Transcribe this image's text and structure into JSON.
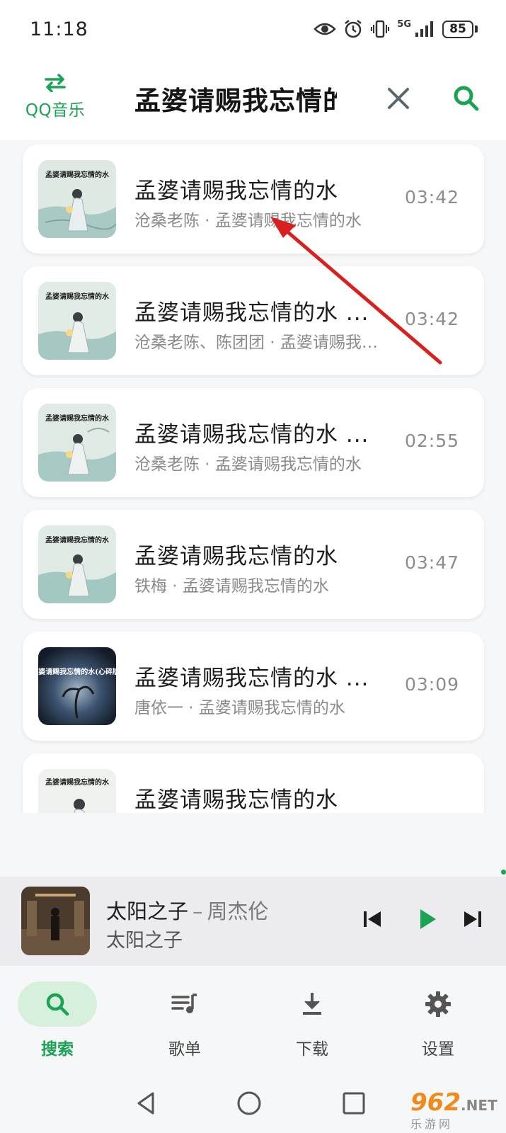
{
  "status_bar": {
    "time": "11:18",
    "network": "5G",
    "battery": "85",
    "icons": [
      "eye-icon",
      "alarm-icon",
      "vibrate-icon",
      "signal-icon",
      "battery-icon"
    ]
  },
  "header": {
    "source_label": "QQ音乐",
    "search_query": "孟婆请赐我忘情的水",
    "icons": [
      "swap-icon",
      "close-icon",
      "search-icon"
    ]
  },
  "results": [
    {
      "title": "孟婆请赐我忘情的水",
      "subtitle": "沧桑老陈 · 孟婆请赐我忘情的水",
      "duration": "03:42"
    },
    {
      "title": "孟婆请赐我忘情的水 ...",
      "subtitle": "沧桑老陈、陈团团 · 孟婆请赐我忘情的水",
      "duration": "03:42"
    },
    {
      "title": "孟婆请赐我忘情的水 ...",
      "subtitle": "沧桑老陈 · 孟婆请赐我忘情的水",
      "duration": "02:55"
    },
    {
      "title": "孟婆请赐我忘情的水",
      "subtitle": "铁梅 · 孟婆请赐我忘情的水",
      "duration": "03:47"
    },
    {
      "title": "孟婆请赐我忘情的水 ...",
      "subtitle": "唐依一 · 孟婆请赐我忘情的水",
      "duration": "03:09"
    },
    {
      "title": "孟婆请赐我忘情的水",
      "subtitle": "",
      "duration": ""
    }
  ],
  "cover_texts": [
    "孟婆请赐我忘情的水",
    "孟婆请赐我忘情的水",
    "孟婆请赐我忘情的水",
    "孟婆请赐我忘情的水",
    "孟婆请赐我忘情的水(心碎版)",
    "孟婆请赐我忘情的水"
  ],
  "player": {
    "title": "太阳之子",
    "separator": "–",
    "artist": "周杰伦",
    "album": "太阳之子",
    "icons": [
      "skip-previous-icon",
      "play-icon",
      "skip-next-icon"
    ]
  },
  "nav": [
    {
      "label": "搜索",
      "icon": "search-icon",
      "active": true
    },
    {
      "label": "歌单",
      "icon": "playlist-icon",
      "active": false
    },
    {
      "label": "下载",
      "icon": "download-icon",
      "active": false
    },
    {
      "label": "设置",
      "icon": "gear-icon",
      "active": false
    }
  ],
  "watermark": {
    "main": "962",
    "net": ".NET",
    "sub": "乐游网"
  },
  "colors": {
    "accent": "#1aa352",
    "arrow": "#d9201f",
    "card_bg": "#ffffff",
    "page_bg": "#f6f7f9"
  }
}
